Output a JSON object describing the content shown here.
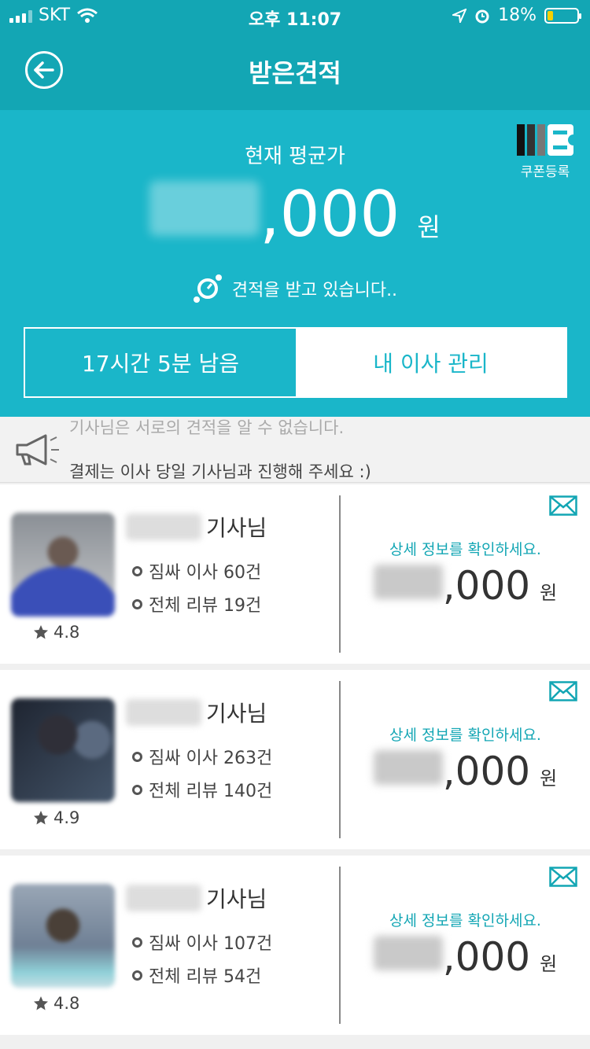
{
  "status_bar": {
    "carrier": "SKT",
    "time": "오후 11:07",
    "battery": "18%",
    "battery_level": 0.18,
    "battery_color": "#f5d100"
  },
  "header": {
    "title": "받은견적",
    "back_icon": "back-arrow-circle-icon"
  },
  "summary": {
    "coupon_label": "쿠폰등록",
    "avg_label": "현재 평균가",
    "avg_price_suffix": ",000",
    "currency": "원",
    "receiving_text": "견적을 받고 있습니다..",
    "timer_label": "17시간 5분 남음",
    "manage_label": "내 이사 관리"
  },
  "notice": {
    "line1": "기사님은 서로의 견적을 알 수 없습니다.",
    "line2": "결제는 이사 당일 기사님과 진행해 주세요 :)"
  },
  "drivers": [
    {
      "suffix": "기사님",
      "moves": "짐싸 이사 60건",
      "reviews": "전체 리뷰 19건",
      "rating": "4.8",
      "detail": "상세 정보를 확인하세요.",
      "price_suffix": ",000",
      "unit": "원"
    },
    {
      "suffix": "기사님",
      "moves": "짐싸 이사 263건",
      "reviews": "전체 리뷰 140건",
      "rating": "4.9",
      "detail": "상세 정보를 확인하세요.",
      "price_suffix": ",000",
      "unit": "원"
    },
    {
      "suffix": "기사님",
      "moves": "짐싸 이사 107건",
      "reviews": "전체 리뷰 54건",
      "rating": "4.8",
      "detail": "상세 정보를 확인하세요.",
      "price_suffix": ",000",
      "unit": "원"
    }
  ],
  "colors": {
    "header_bg": "#13a6b4",
    "summary_bg": "#1ab6c9",
    "accent_text": "#13a6b4"
  }
}
